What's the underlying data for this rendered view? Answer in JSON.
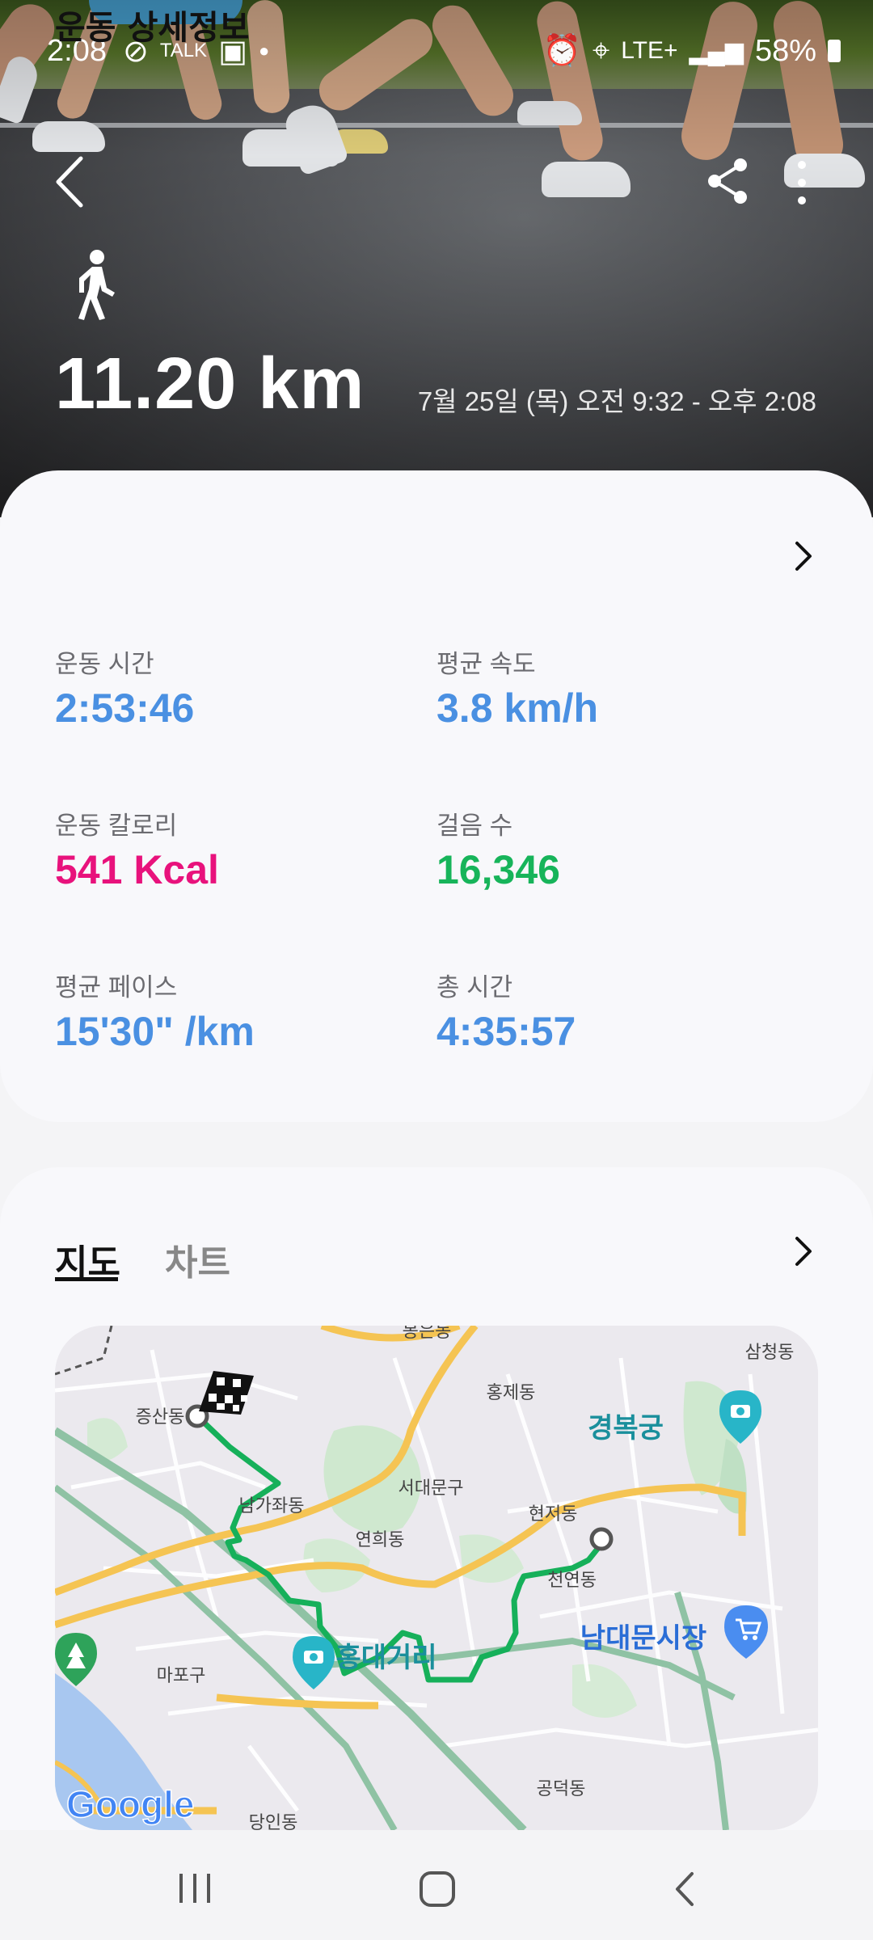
{
  "status_bar": {
    "time": "2:08",
    "battery": "58%",
    "network": "LTE+"
  },
  "header": {
    "activity_icon": "walk-icon",
    "distance": "11.20 km",
    "datetime": "7월 25일 (목) 오전 9:32 - 오후 2:08"
  },
  "details": {
    "title": "운동 상세정보",
    "stats": [
      {
        "label": "운동 시간",
        "value": "2:53:46",
        "color": "#4a90e2"
      },
      {
        "label": "평균 속도",
        "value": "3.8 km/h",
        "color": "#4a90e2"
      },
      {
        "label": "운동 칼로리",
        "value": "541 Kcal",
        "color": "#e8127c"
      },
      {
        "label": "걸음 수",
        "value": "16,346",
        "color": "#17b45a"
      },
      {
        "label": "평균 페이스",
        "value": "15'30\" /km",
        "color": "#4a90e2"
      },
      {
        "label": "총 시간",
        "value": "4:35:57",
        "color": "#4a90e2"
      }
    ]
  },
  "map_section": {
    "tabs": [
      {
        "label": "지도",
        "active": true
      },
      {
        "label": "차트",
        "active": false
      }
    ],
    "map_labels": {
      "top": "봉은동",
      "samcheong": "삼청동",
      "hongje": "홍제동",
      "jeungsan": "증산동",
      "gyeongbok": "경복궁",
      "seodaemun": "서대문구",
      "namgajwa": "남가좌동",
      "yeonhui": "연희동",
      "hyeonjeo": "현저동",
      "cheonyeon": "천연동",
      "namdaemun": "남대문시장",
      "mapo": "마포구",
      "hongdae": "홍대거리",
      "gongdeok": "공덕동",
      "dangin": "당인동"
    },
    "map_logo": "Google"
  },
  "colors": {
    "route": "#16b05a",
    "accent_blue": "#4a90e2",
    "accent_pink": "#e8127c",
    "accent_green": "#17b45a"
  }
}
